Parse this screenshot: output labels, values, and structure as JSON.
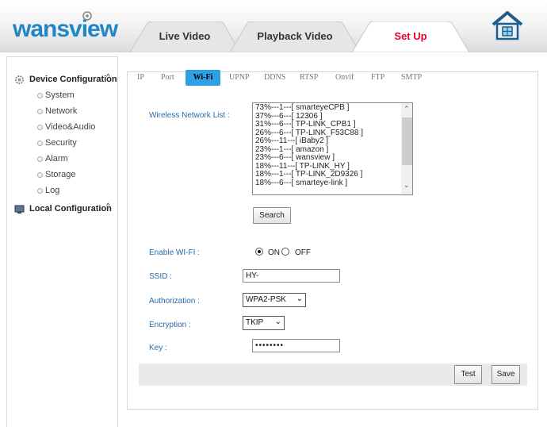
{
  "header": {
    "logo_text": "wansview",
    "tabs": [
      {
        "label": "Live Video"
      },
      {
        "label": "Playback Video"
      },
      {
        "label": "Set Up"
      }
    ]
  },
  "sidebar": {
    "device": {
      "title": "Device Configuration",
      "caret": "^",
      "items": [
        {
          "label": "System"
        },
        {
          "label": "Network"
        },
        {
          "label": "Video&Audio"
        },
        {
          "label": "Security"
        },
        {
          "label": "Alarm"
        },
        {
          "label": "Storage"
        },
        {
          "label": "Log"
        }
      ]
    },
    "local": {
      "title": "Local Configuration",
      "caret": "^"
    }
  },
  "subtabs": [
    {
      "label": "IP"
    },
    {
      "label": "Port"
    },
    {
      "label": "Wi-Fi"
    },
    {
      "label": "UPNP"
    },
    {
      "label": "DDNS"
    },
    {
      "label": "RTSP"
    },
    {
      "label": "Onvif"
    },
    {
      "label": "FTP"
    },
    {
      "label": "SMTP"
    }
  ],
  "wifi": {
    "list_label": "Wireless Network List :",
    "networks": [
      {
        "entry": "73%---1---[ smarteyeCPB ]"
      },
      {
        "entry": "37%---6---[ 12306 ]"
      },
      {
        "entry": "31%---6---[ TP-LINK_CPB1 ]"
      },
      {
        "entry": "26%---6---[ TP-LINK_F53C88 ]"
      },
      {
        "entry": "26%---11---[ iBaby2 ]"
      },
      {
        "entry": "23%---1---[ amazon ]"
      },
      {
        "entry": "23%---6---[ wansview ]"
      },
      {
        "entry": "18%---11---[ TP-LINK_HY ]"
      },
      {
        "entry": "18%---1---[ TP-LINK_2D9326 ]"
      },
      {
        "entry": "18%---6---[ smarteye-link ]"
      }
    ],
    "search_button": "Search",
    "enable_label": "Enable WI-FI :",
    "enable_on": "ON",
    "enable_off": "OFF",
    "enable_selected": "ON",
    "ssid_label": "SSID :",
    "ssid_value": "HY-",
    "auth_label": "Authorization :",
    "auth_value": "WPA2-PSK",
    "enc_label": "Encryption :",
    "enc_value": "TKIP",
    "key_label": "Key :",
    "key_value": "••••••••",
    "test_button": "Test",
    "save_button": "Save"
  },
  "colors": {
    "active_subtab": "#2f9fe6",
    "active_tab_text": "#e4002b",
    "logo": "#1f86c7",
    "field_label": "#2a6aa8"
  }
}
